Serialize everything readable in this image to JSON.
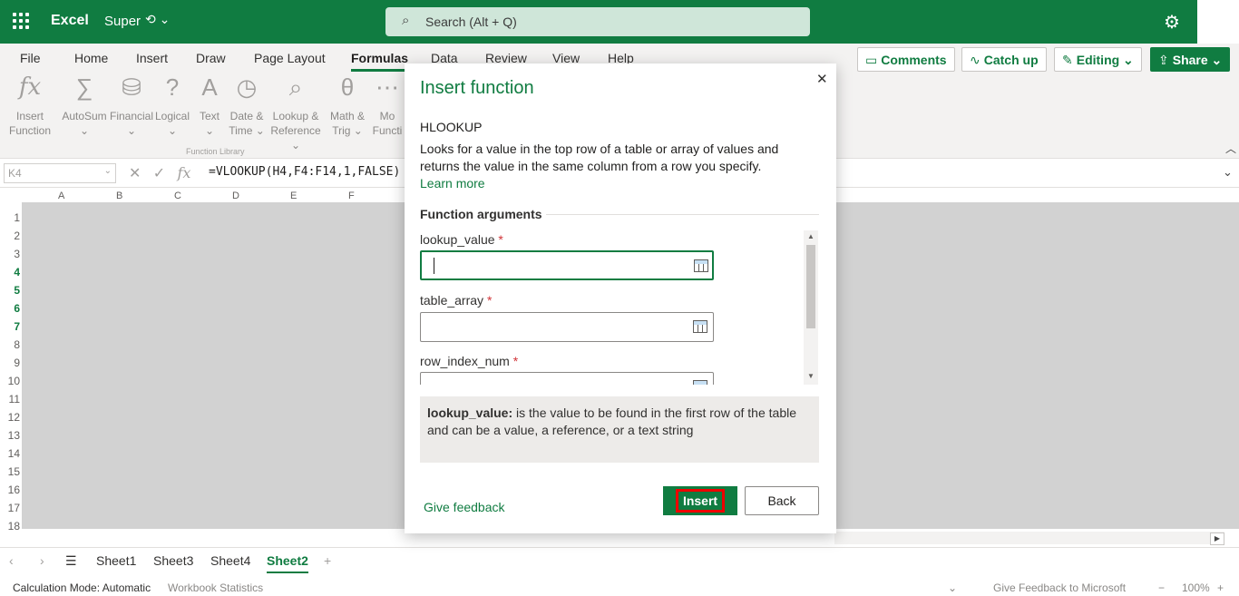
{
  "app": {
    "name": "Excel",
    "doc_name": "Super",
    "doc_extra": "⟲ ⌄"
  },
  "search": {
    "placeholder": "Search (Alt + Q)"
  },
  "ribbon_tabs": [
    "File",
    "Home",
    "Insert",
    "Draw",
    "Page Layout",
    "Formulas",
    "Data",
    "Review",
    "View",
    "Help"
  ],
  "active_tab": "Formulas",
  "right_buttons": {
    "comments": "Comments",
    "catchup": "Catch up",
    "editing": "Editing",
    "share": "Share"
  },
  "ribbon": {
    "insert_function": [
      "Insert",
      "Function"
    ],
    "autosum": "AutoSum",
    "financial": "Financial",
    "logical": "Logical",
    "text": "Text",
    "datetime": [
      "Date &",
      "Time"
    ],
    "lookup": [
      "Lookup &",
      "Reference"
    ],
    "math": [
      "Math &",
      "Trig"
    ],
    "more": [
      "Mo",
      "Functi"
    ],
    "group_label": "Function Library"
  },
  "formula_bar": {
    "name_box": "K4",
    "formula": "=VLOOKUP(H4,F4:F14,1,FALSE)"
  },
  "columns": [
    "A",
    "B",
    "C",
    "D",
    "E",
    "F"
  ],
  "rows": [
    "1",
    "2",
    "3",
    "4",
    "5",
    "6",
    "7",
    "8",
    "9",
    "10",
    "11",
    "12",
    "13",
    "14",
    "15",
    "16",
    "17",
    "18"
  ],
  "sheets": [
    "Sheet1",
    "Sheet3",
    "Sheet4",
    "Sheet2"
  ],
  "active_sheet": "Sheet2",
  "status": {
    "calc_mode": "Calculation Mode: Automatic",
    "workbook_stats": "Workbook Statistics",
    "feedback": "Give Feedback to Microsoft",
    "zoom": "100%"
  },
  "dialog": {
    "title": "Insert function",
    "function_name": "HLOOKUP",
    "description": "Looks for a value in the top row of a table or array of values and returns the value in the same column from a row you specify.",
    "learn_more": "Learn more",
    "args_heading": "Function arguments",
    "args": [
      {
        "label": "lookup_value",
        "value": ""
      },
      {
        "label": "table_array",
        "value": ""
      },
      {
        "label": "row_index_num",
        "value": ""
      }
    ],
    "required_mark": "*",
    "help_term": "lookup_value:",
    "help_text": "is the value to be found in the first row of the table and can be a value, a reference, or a text string",
    "give_feedback": "Give feedback",
    "insert_label": "Insert",
    "back_label": "Back"
  },
  "colors": {
    "accent": "#107c41",
    "highlight": "#e00000"
  }
}
